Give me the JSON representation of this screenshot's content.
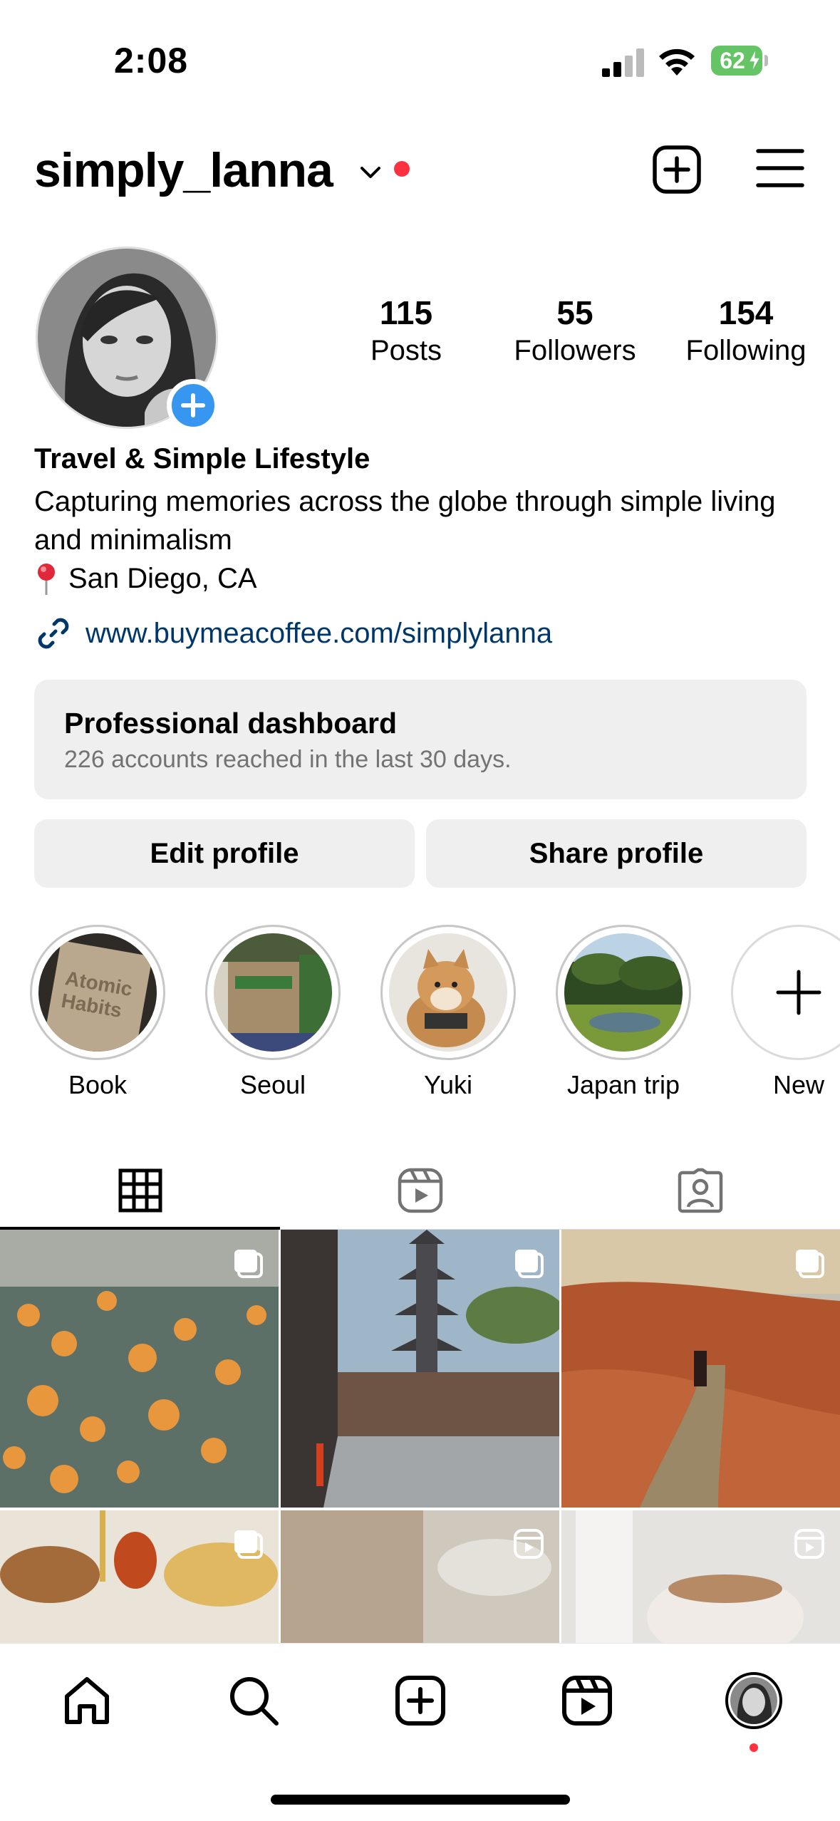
{
  "status_bar": {
    "time": "2:08",
    "battery": "62"
  },
  "header": {
    "username": "simply_lanna"
  },
  "profile": {
    "stats": [
      {
        "value": "115",
        "label": "Posts"
      },
      {
        "value": "55",
        "label": "Followers"
      },
      {
        "value": "154",
        "label": "Following"
      }
    ],
    "bio_title": "Travel & Simple Lifestyle",
    "bio_text": "Capturing memories across the globe through simple living and minimalism",
    "location": "San Diego, CA",
    "link": "www.buymeacoffee.com/simplylanna"
  },
  "dashboard": {
    "title": "Professional dashboard",
    "subtitle": "226 accounts reached in the last 30 days."
  },
  "buttons": {
    "edit": "Edit profile",
    "share": "Share profile"
  },
  "highlights": [
    {
      "label": "Book"
    },
    {
      "label": "Seoul"
    },
    {
      "label": "Yuki"
    },
    {
      "label": "Japan trip"
    },
    {
      "label": "New"
    }
  ],
  "tabs": [
    "grid-icon",
    "reels-icon",
    "tagged-icon"
  ],
  "colors": {
    "accent_blue": "#3797f0",
    "link": "#00376b",
    "notification": "#ff3040",
    "battery": "#65c466"
  }
}
